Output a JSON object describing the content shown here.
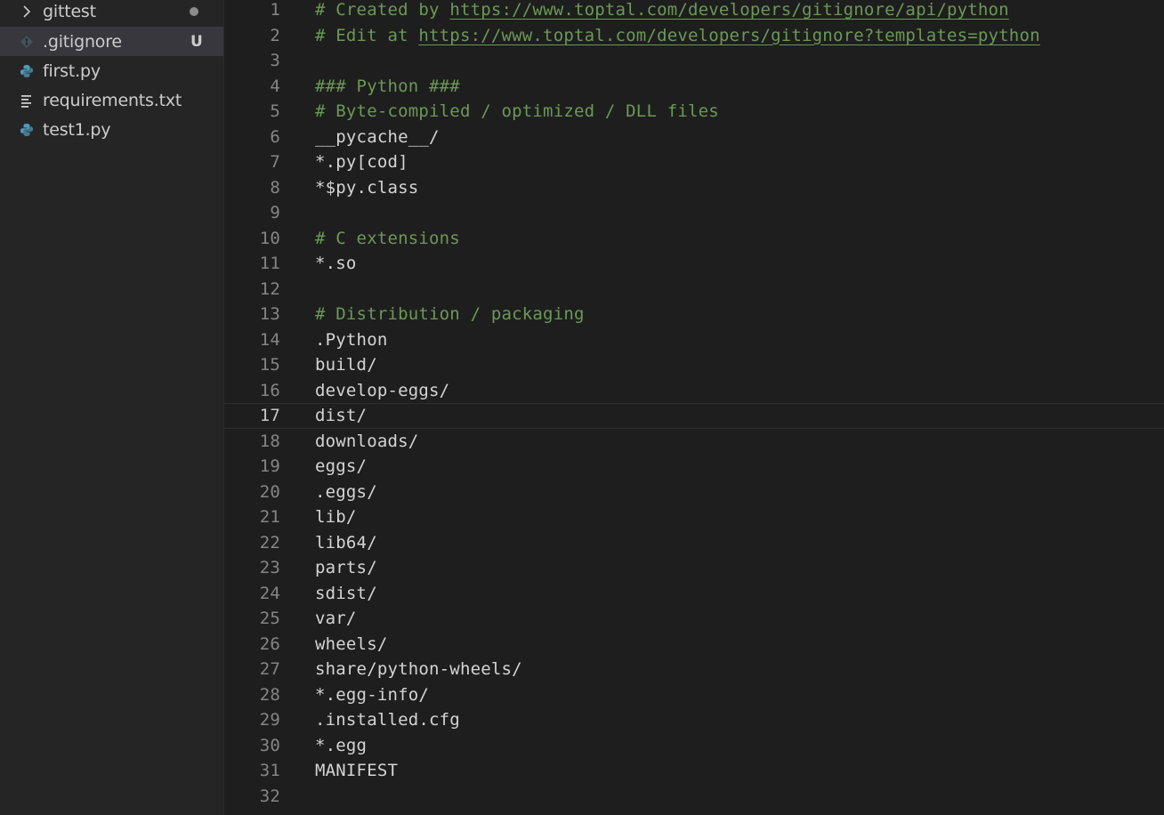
{
  "sidebar": {
    "items": [
      {
        "label": "gittest",
        "icon": "chevron-right-icon",
        "git": "dot"
      },
      {
        "label": ".gitignore",
        "icon": "git-file-icon",
        "git_status": "U",
        "selected": true
      },
      {
        "label": "first.py",
        "icon": "python-icon"
      },
      {
        "label": "requirements.txt",
        "icon": "text-lines-icon"
      },
      {
        "label": "test1.py",
        "icon": "python-icon"
      }
    ]
  },
  "editor": {
    "active_line": 17,
    "colors": {
      "comment": "#6a9955",
      "text": "#d4d4d4",
      "line_number": "#858585"
    },
    "lines": [
      {
        "n": "1",
        "comment": true,
        "prefix": "# Created by ",
        "link": "https://www.toptal.com/developers/gitignore/api/python"
      },
      {
        "n": "2",
        "comment": true,
        "prefix": "# Edit at ",
        "link": "https://www.toptal.com/developers/gitignore?templates=python"
      },
      {
        "n": "3",
        "text": ""
      },
      {
        "n": "4",
        "comment": true,
        "text": "### Python ###"
      },
      {
        "n": "5",
        "comment": true,
        "text": "# Byte-compiled / optimized / DLL files"
      },
      {
        "n": "6",
        "text": "__pycache__/"
      },
      {
        "n": "7",
        "text": "*.py[cod]"
      },
      {
        "n": "8",
        "text": "*$py.class"
      },
      {
        "n": "9",
        "text": ""
      },
      {
        "n": "10",
        "comment": true,
        "text": "# C extensions"
      },
      {
        "n": "11",
        "text": "*.so"
      },
      {
        "n": "12",
        "text": ""
      },
      {
        "n": "13",
        "comment": true,
        "text": "# Distribution / packaging"
      },
      {
        "n": "14",
        "text": ".Python"
      },
      {
        "n": "15",
        "text": "build/"
      },
      {
        "n": "16",
        "text": "develop-eggs/"
      },
      {
        "n": "17",
        "text": "dist/"
      },
      {
        "n": "18",
        "text": "downloads/"
      },
      {
        "n": "19",
        "text": "eggs/"
      },
      {
        "n": "20",
        "text": ".eggs/"
      },
      {
        "n": "21",
        "text": "lib/"
      },
      {
        "n": "22",
        "text": "lib64/"
      },
      {
        "n": "23",
        "text": "parts/"
      },
      {
        "n": "24",
        "text": "sdist/"
      },
      {
        "n": "25",
        "text": "var/"
      },
      {
        "n": "26",
        "text": "wheels/"
      },
      {
        "n": "27",
        "text": "share/python-wheels/"
      },
      {
        "n": "28",
        "text": "*.egg-info/"
      },
      {
        "n": "29",
        "text": ".installed.cfg"
      },
      {
        "n": "30",
        "text": "*.egg"
      },
      {
        "n": "31",
        "text": "MANIFEST"
      },
      {
        "n": "32",
        "text": ""
      }
    ]
  }
}
